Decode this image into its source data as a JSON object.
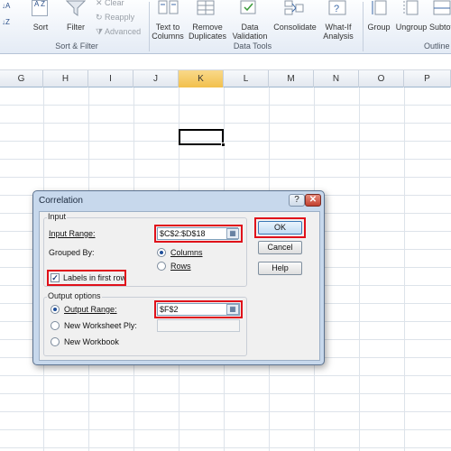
{
  "ribbon": {
    "sort_filter": {
      "sort_label": "Sort",
      "filter_label": "Filter",
      "clear_label": "Clear",
      "reapply_label": "Reapply",
      "advanced_label": "Advanced",
      "group_label": "Sort & Filter"
    },
    "data_tools": {
      "text_to_columns_label": "Text to Columns",
      "remove_duplicates_label": "Remove Duplicates",
      "data_validation_label": "Data Validation",
      "consolidate_label": "Consolidate",
      "what_if_label": "What-If Analysis",
      "group_label": "Data Tools"
    },
    "outline": {
      "group_btn_label": "Group",
      "ungroup_label": "Ungroup",
      "subtotal_label": "Subtot",
      "group_label": "Outline"
    }
  },
  "columns": [
    "G",
    "H",
    "I",
    "J",
    "K",
    "L",
    "M",
    "N",
    "O",
    "P"
  ],
  "active_column": "K",
  "dialog": {
    "title": "Correlation",
    "help_label": "?",
    "close_label": "✕",
    "input_section_label": "Input",
    "input_range_label": "Input Range:",
    "input_range_value": "$C$2:$D$18",
    "grouped_by_label": "Grouped By:",
    "grouped_by_options": [
      "Columns",
      "Rows"
    ],
    "grouped_by_selected": "Columns",
    "labels_first_row_label": "Labels in first row",
    "labels_first_row_checked": true,
    "output_section_label": "Output options",
    "output_options": [
      "Output Range:",
      "New Worksheet Ply:",
      "New Workbook"
    ],
    "output_selected": "Output Range:",
    "output_range_value": "$F$2",
    "ok_label": "OK",
    "cancel_label": "Cancel",
    "help_button_label": "Help"
  },
  "highlight_color": "#e0101a"
}
